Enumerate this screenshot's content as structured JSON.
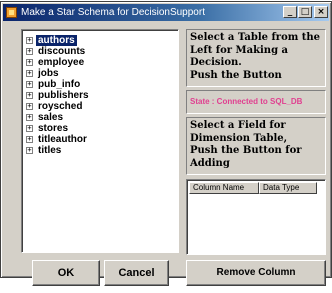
{
  "window": {
    "title": "Make a Star Schema for DecisionSupport",
    "controls": {
      "minimize": "_",
      "maximize": "□",
      "close": "×"
    }
  },
  "tables_tree": {
    "expander": "+",
    "selected": "authors",
    "items": [
      "authors",
      "discounts",
      "employee",
      "jobs",
      "pub_info",
      "publishers",
      "roysched",
      "sales",
      "stores",
      "titleauthor",
      "titles"
    ]
  },
  "instructions": {
    "table_line1": "Select a Table from the",
    "table_line2": "Left for Making a",
    "table_line3": "Decision.",
    "table_line4": "Push the Button",
    "field_line1": "Select a Field for",
    "field_line2": "Dimension Table,",
    "field_line3": "Push the Button for",
    "field_line4": "Adding"
  },
  "status": {
    "text": "State : Connected to SQL_DB",
    "color": "#e04090"
  },
  "columns_list": {
    "headers": [
      "Column Name",
      "Data Type"
    ],
    "rows": []
  },
  "buttons": {
    "ok": "OK",
    "cancel": "Cancel",
    "remove_column": "Remove Column"
  },
  "colors": {
    "face": "#d4d0c8",
    "title_active": "#0a246a",
    "selection": "#0a246a"
  }
}
